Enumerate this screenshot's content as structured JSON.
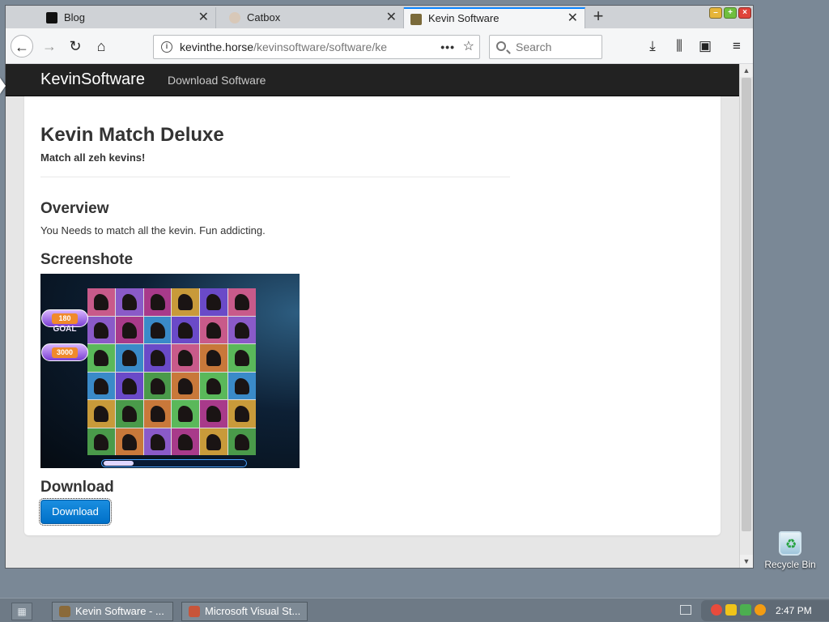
{
  "tabs": [
    {
      "label": "Blog",
      "close": "✕"
    },
    {
      "label": "Catbox",
      "close": "✕"
    },
    {
      "label": "Kevin Software",
      "close": "✕"
    }
  ],
  "toolbar": {
    "url_host": "kevinthe.horse",
    "url_path": "/kevinsoftware/software/ke",
    "search_placeholder": "Search"
  },
  "site": {
    "brand": "KevinSoftware",
    "nav_link": "Download Software"
  },
  "page": {
    "title": "Kevin Match Deluxe",
    "subtitle": "Match all zeh kevins!",
    "overview_heading": "Overview",
    "overview_text": "You Needs to match all the kevin. Fun addicting.",
    "screenshot_heading": "Screenshote",
    "download_heading": "Download",
    "download_button": "Download"
  },
  "screenshot": {
    "score": "180",
    "goal_label": "GOAL",
    "goal": "3000",
    "progress_fraction": 0.06
  },
  "desktop": {
    "recycle_bin": "Recycle Bin"
  },
  "taskbar": {
    "tasks": [
      "Kevin Software - ...",
      "Microsoft Visual St..."
    ],
    "clock": "2:47 PM"
  },
  "colors": {
    "tab_accent": "#0a84ff",
    "navbar_bg": "#222222",
    "button_blue": "#0070c8"
  }
}
